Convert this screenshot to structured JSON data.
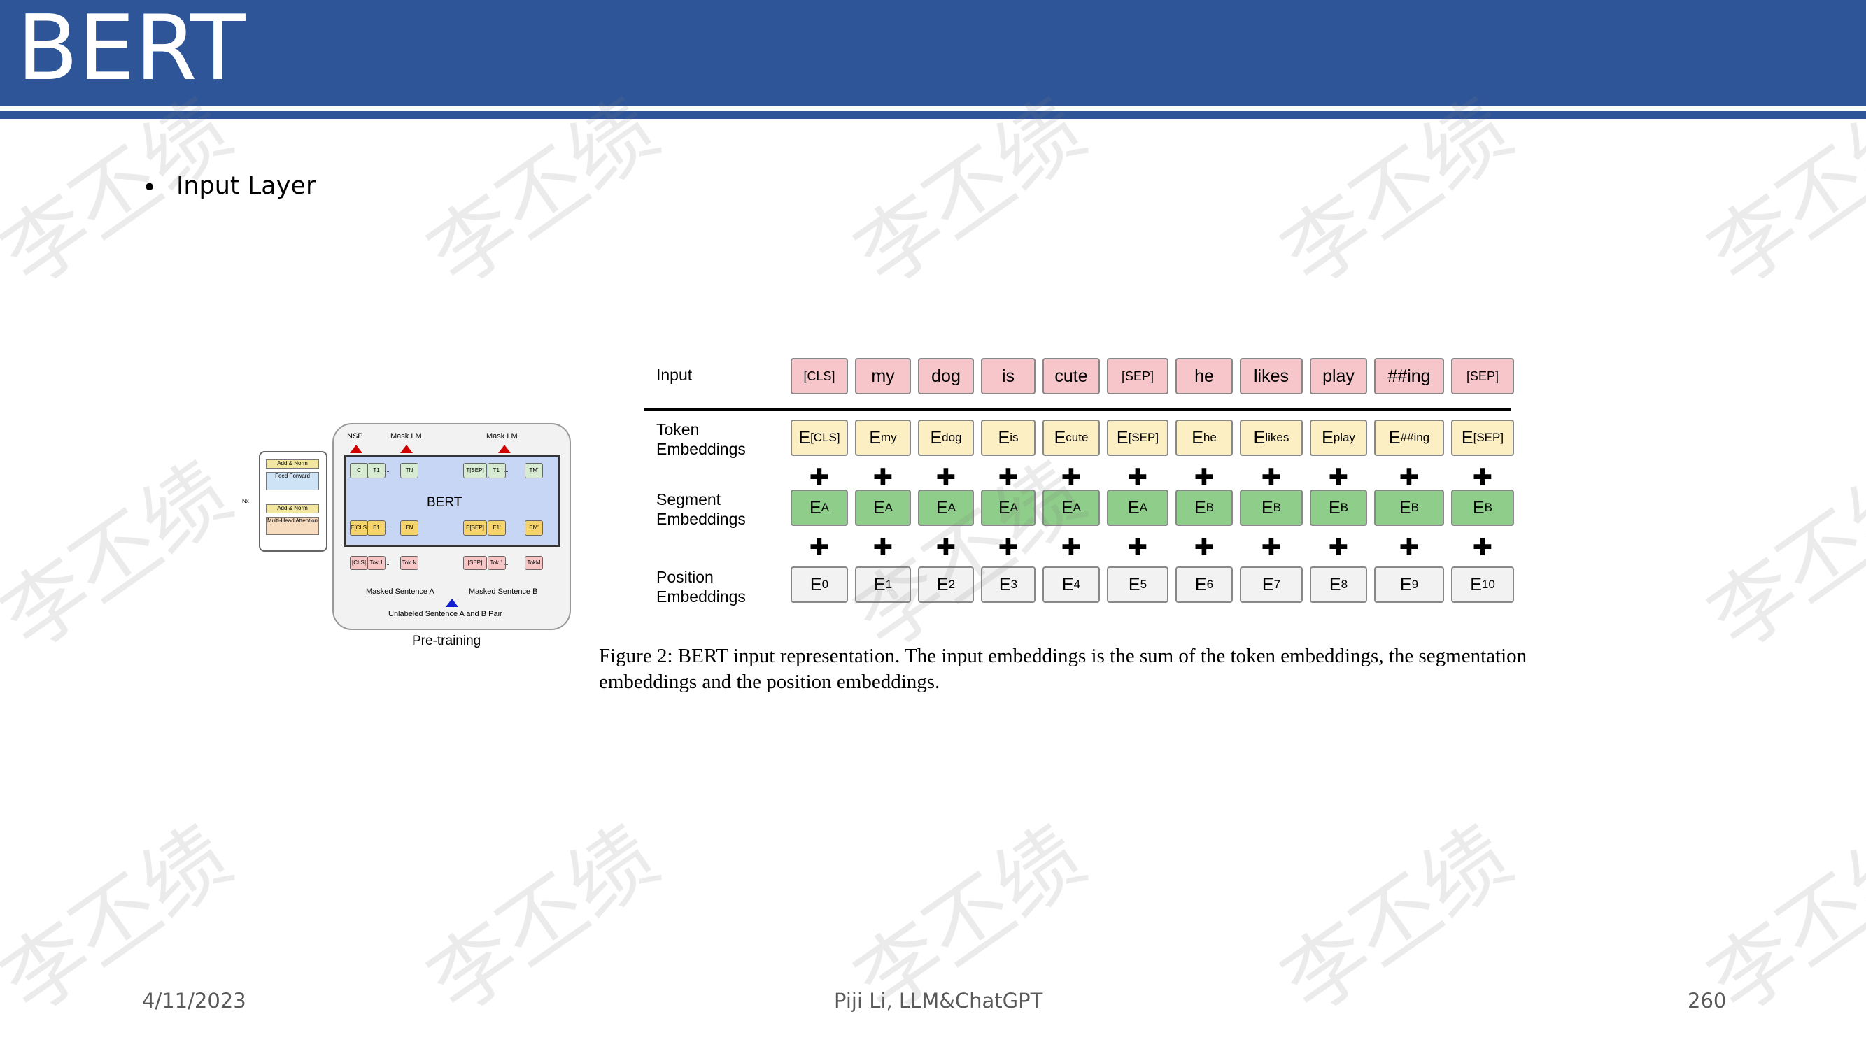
{
  "slide": {
    "title": "BERT",
    "bullet_symbol": "•",
    "bullet": "Input Layer"
  },
  "pretraining": {
    "nsp": "NSP",
    "mask_lm_1": "Mask LM",
    "mask_lm_2": "Mask LM",
    "bert_label": "BERT",
    "nx": "Nx",
    "add_norm_1": "Add & Norm",
    "feed_forward": "Feed Forward",
    "add_norm_2": "Add & Norm",
    "multi_head": "Multi-Head Attention",
    "out_tokens": [
      "C",
      "T1",
      "...",
      "TN",
      "T[SEP]",
      "T1'",
      "...",
      "TM'"
    ],
    "emb_tokens": [
      "E[CLS]",
      "E1",
      "...",
      "EN",
      "E[SEP]",
      "E1'",
      "...",
      "EM'"
    ],
    "in_tokens": [
      "[CLS]",
      "Tok 1",
      "...",
      "Tok N",
      "[SEP]",
      "Tok 1",
      "...",
      "TokM"
    ],
    "masked_a": "Masked Sentence A",
    "masked_b": "Masked Sentence B",
    "unlabeled": "Unlabeled Sentence A and B Pair",
    "caption": "Pre-training"
  },
  "input_rep": {
    "row_labels": {
      "input": "Input",
      "token": [
        "Token",
        "Embeddings"
      ],
      "segment": [
        "Segment",
        "Embeddings"
      ],
      "position": [
        "Position",
        "Embeddings"
      ]
    },
    "plus": "✚",
    "tokens": [
      {
        "input": "[CLS]",
        "tok_base": "E",
        "tok_sub": "[CLS]",
        "seg_sub": "A",
        "pos_sub": "0"
      },
      {
        "input": "my",
        "tok_base": "E",
        "tok_sub": "my",
        "seg_sub": "A",
        "pos_sub": "1"
      },
      {
        "input": "dog",
        "tok_base": "E",
        "tok_sub": "dog",
        "seg_sub": "A",
        "pos_sub": "2"
      },
      {
        "input": "is",
        "tok_base": "E",
        "tok_sub": "is",
        "seg_sub": "A",
        "pos_sub": "3"
      },
      {
        "input": "cute",
        "tok_base": "E",
        "tok_sub": "cute",
        "seg_sub": "A",
        "pos_sub": "4"
      },
      {
        "input": "[SEP]",
        "tok_base": "E",
        "tok_sub": "[SEP]",
        "seg_sub": "A",
        "pos_sub": "5"
      },
      {
        "input": "he",
        "tok_base": "E",
        "tok_sub": "he",
        "seg_sub": "B",
        "pos_sub": "6"
      },
      {
        "input": "likes",
        "tok_base": "E",
        "tok_sub": "likes",
        "seg_sub": "B",
        "pos_sub": "7"
      },
      {
        "input": "play",
        "tok_base": "E",
        "tok_sub": "play",
        "seg_sub": "B",
        "pos_sub": "8"
      },
      {
        "input": "##ing",
        "tok_base": "E",
        "tok_sub": "##ing",
        "seg_sub": "B",
        "pos_sub": "9"
      },
      {
        "input": "[SEP]",
        "tok_base": "E",
        "tok_sub": "[SEP]",
        "seg_sub": "B",
        "pos_sub": "10"
      }
    ]
  },
  "figure_caption": "Figure 2: BERT input representation. The input embeddings is the sum of the token embeddings, the segmentation embeddings and the position embeddings.",
  "footer": {
    "date": "4/11/2023",
    "center": "Piji Li, LLM&ChatGPT",
    "page": "260"
  },
  "watermark": "李丕绩"
}
